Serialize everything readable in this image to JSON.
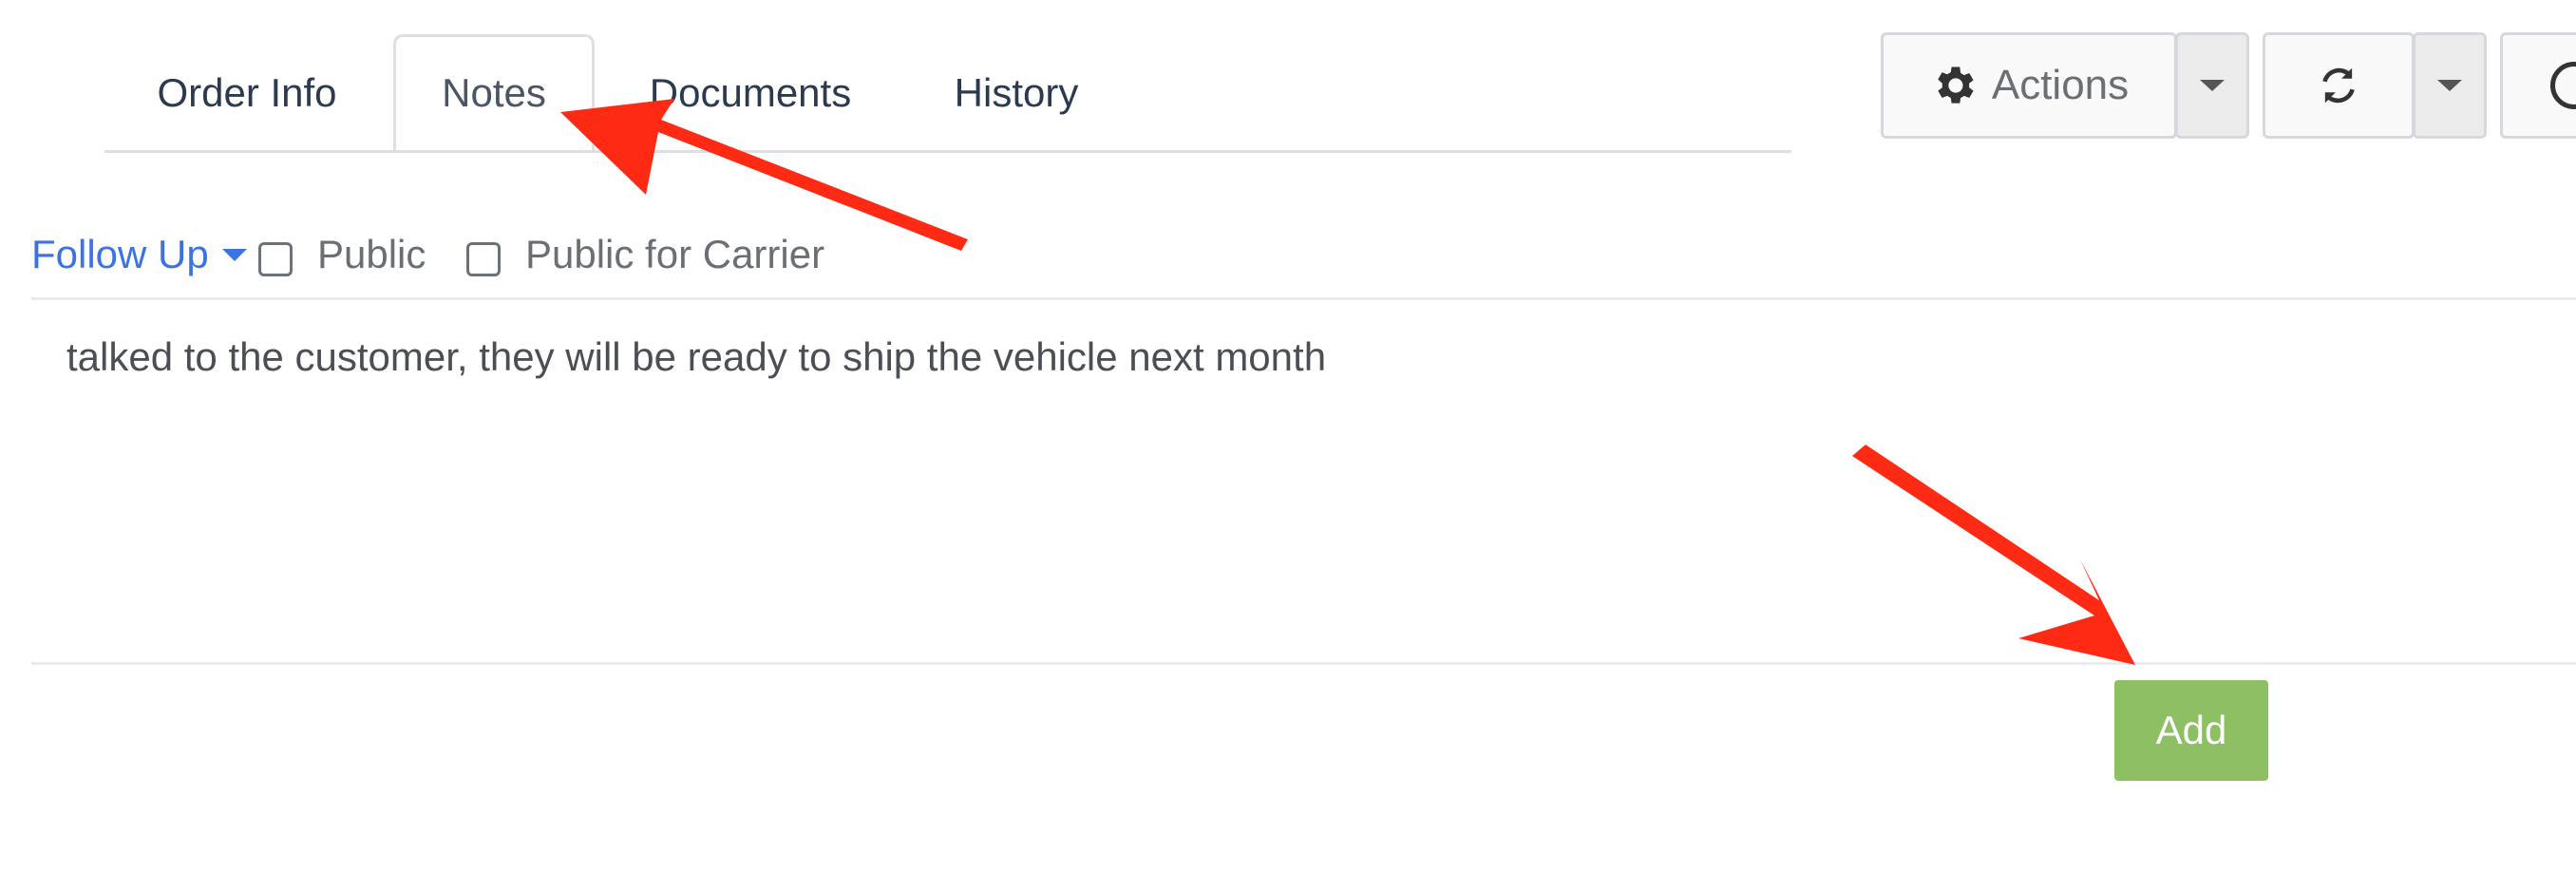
{
  "tabs": [
    {
      "label": "Order Info",
      "active": false
    },
    {
      "label": "Notes",
      "active": true
    },
    {
      "label": "Documents",
      "active": false
    },
    {
      "label": "History",
      "active": false
    }
  ],
  "toolbar": {
    "actions_label": "Actions",
    "actions_icon": "gear-icon",
    "refresh_icon": "refresh-icon",
    "caret_icon": "caret-down-icon"
  },
  "note_options": {
    "follow_up_label": "Follow Up",
    "public_label": "Public",
    "public_checked": false,
    "public_for_carrier_label": "Public for Carrier",
    "public_for_carrier_checked": false
  },
  "note": {
    "text": "talked to the customer, they will be ready to ship the vehicle next month"
  },
  "add_button_label": "Add",
  "annotation_color": "#ff2a14"
}
